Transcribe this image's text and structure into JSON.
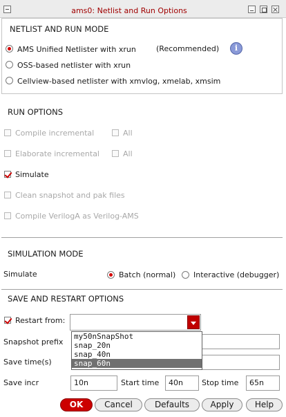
{
  "window": {
    "title": "ams0: Netlist and Run Options"
  },
  "netlist_mode": {
    "heading": "NETLIST AND RUN MODE",
    "options": [
      {
        "label": "AMS Unified Netlister with xrun",
        "selected": true
      },
      {
        "label": "OSS-based netlister with xrun",
        "selected": false
      },
      {
        "label": "Cellview-based netlister with xmvlog, xmelab, xmsim",
        "selected": false
      }
    ],
    "recommended": "(Recommended)",
    "info_icon_glyph": "i"
  },
  "run_options": {
    "heading": "RUN OPTIONS",
    "compile_incremental": {
      "label": "Compile incremental",
      "checked": false,
      "enabled": false
    },
    "compile_all": {
      "label": "All",
      "checked": false,
      "enabled": false
    },
    "elaborate_incremental": {
      "label": "Elaborate incremental",
      "checked": false,
      "enabled": false
    },
    "elaborate_all": {
      "label": "All",
      "checked": false,
      "enabled": false
    },
    "simulate": {
      "label": "Simulate",
      "checked": true,
      "enabled": true
    },
    "clean_snapshot": {
      "label": "Clean snapshot and pak files",
      "checked": false,
      "enabled": false
    },
    "compile_veriloga": {
      "label": "Compile VerilogA as Verilog-AMS",
      "checked": false,
      "enabled": false
    }
  },
  "simulation_mode": {
    "heading": "SIMULATION MODE",
    "label": "Simulate",
    "batch": {
      "label": "Batch (normal)",
      "selected": true
    },
    "interactive": {
      "label": "Interactive (debugger)",
      "selected": false
    }
  },
  "save_restart": {
    "heading": "SAVE AND RESTART OPTIONS",
    "restart_from": {
      "label": "Restart from:",
      "checked": true,
      "value": ""
    },
    "dropdown_options": [
      "my50nSnapShot",
      "snap_20n",
      "snap_40n",
      "snap_60n"
    ],
    "dropdown_selected": "snap_60n",
    "snapshot_prefix": {
      "label": "Snapshot prefix",
      "value": ""
    },
    "save_times": {
      "label": "Save time(s)",
      "value": ""
    },
    "save_incr": {
      "label": "Save incr",
      "value": "10n"
    },
    "start_time": {
      "label": "Start time",
      "value": "40n"
    },
    "stop_time": {
      "label": "Stop time",
      "value": "65n"
    }
  },
  "buttons": {
    "ok": "OK",
    "cancel": "Cancel",
    "defaults": "Defaults",
    "apply": "Apply",
    "help": "Help"
  },
  "colors": {
    "accent": "#cc0000",
    "title_text": "#a00000",
    "info_icon": "#8a9ad8"
  }
}
